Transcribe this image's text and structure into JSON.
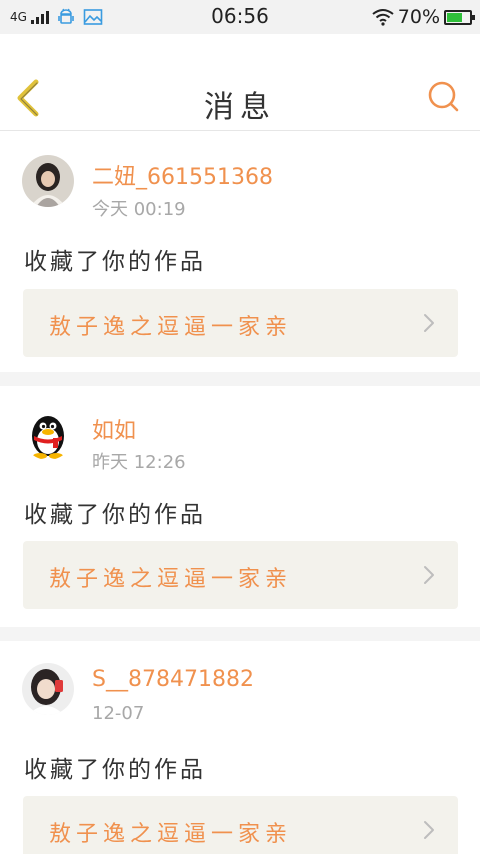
{
  "status_bar": {
    "network": "4G",
    "time": "06:56",
    "battery": "70%",
    "battery_level": 0.7,
    "icons": [
      "signal-icon",
      "android-icon",
      "image-icon",
      "wifi-icon",
      "battery-icon"
    ]
  },
  "header": {
    "title": "消息",
    "back_icon": "chevron-left-icon",
    "search_icon": "search-icon"
  },
  "colors": {
    "accent": "#f0914e",
    "back_arrow": "#e0c23a",
    "card_bg": "#f3f2ec"
  },
  "messages": [
    {
      "username": "二妞_661551368",
      "time": "今天 00:19",
      "action": "收藏了你的作品",
      "work_title": "敖子逸之逗逼一家亲",
      "avatar": "girl-photo-avatar"
    },
    {
      "username": "如如",
      "time": "昨天 12:26",
      "action": "收藏了你的作品",
      "work_title": "敖子逸之逗逼一家亲",
      "avatar": "penguin-avatar"
    },
    {
      "username": "S__878471882",
      "time": "12-07",
      "action": "收藏了你的作品",
      "work_title": "敖子逸之逗逼一家亲",
      "avatar": "girl-selfie-avatar"
    }
  ]
}
